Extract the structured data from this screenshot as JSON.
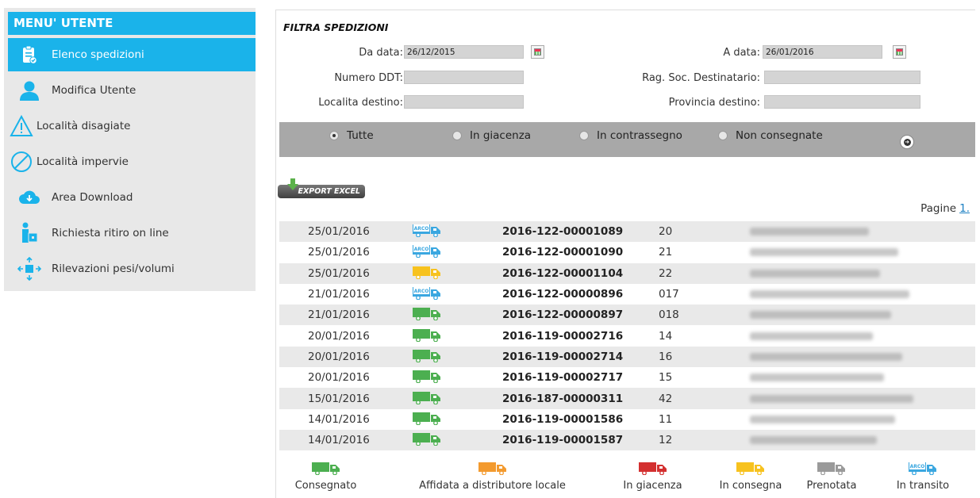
{
  "sidebar": {
    "title": "MENU' UTENTE",
    "items": [
      {
        "label": "Elenco spedizioni",
        "icon": "clipboard-icon",
        "active": true
      },
      {
        "label": "Modifica Utente",
        "icon": "user-icon",
        "active": false
      },
      {
        "label": "Località disagiate",
        "icon": "warning-icon",
        "active": false
      },
      {
        "label": "Località impervie",
        "icon": "forbidden-icon",
        "active": false
      },
      {
        "label": "Area Download",
        "icon": "cloud-download-icon",
        "active": false
      },
      {
        "label": "Richiesta ritiro on line",
        "icon": "person-box-icon",
        "active": false
      },
      {
        "label": "Rilevazioni pesi/volumi",
        "icon": "box-arrows-icon",
        "active": false
      }
    ]
  },
  "filter": {
    "title": "FILTRA SPEDIZIONI",
    "da_data_label": "Da data:",
    "da_data_value": "26/12/2015",
    "a_data_label": "A data:",
    "a_data_value": "26/01/2016",
    "numero_ddt_label": "Numero DDT:",
    "numero_ddt_value": "",
    "rag_soc_label": "Rag. Soc. Destinatario:",
    "rag_soc_value": "",
    "localita_label": "Localita destino:",
    "localita_value": "",
    "provincia_label": "Provincia destino:",
    "provincia_value": "",
    "radios": [
      {
        "label": "Tutte",
        "selected": true
      },
      {
        "label": "In giacenza",
        "selected": false
      },
      {
        "label": "In contrassegno",
        "selected": false
      },
      {
        "label": "Non consegnate",
        "selected": false
      }
    ]
  },
  "export_label": "EXPORT EXCEL",
  "pagination": {
    "label": "Pagine",
    "current": "1."
  },
  "shipments": [
    {
      "date": "25/01/2016",
      "status": "in-transito",
      "ddt": "2016-122-00001089",
      "num": "20"
    },
    {
      "date": "25/01/2016",
      "status": "in-transito",
      "ddt": "2016-122-00001090",
      "num": "21"
    },
    {
      "date": "25/01/2016",
      "status": "in-consegna",
      "ddt": "2016-122-00001104",
      "num": "22"
    },
    {
      "date": "21/01/2016",
      "status": "in-transito",
      "ddt": "2016-122-00000896",
      "num": "017"
    },
    {
      "date": "21/01/2016",
      "status": "consegnato",
      "ddt": "2016-122-00000897",
      "num": "018"
    },
    {
      "date": "20/01/2016",
      "status": "consegnato",
      "ddt": "2016-119-00002716",
      "num": "14"
    },
    {
      "date": "20/01/2016",
      "status": "consegnato",
      "ddt": "2016-119-00002714",
      "num": "16"
    },
    {
      "date": "20/01/2016",
      "status": "consegnato",
      "ddt": "2016-119-00002717",
      "num": "15"
    },
    {
      "date": "15/01/2016",
      "status": "consegnato",
      "ddt": "2016-187-00000311",
      "num": "42"
    },
    {
      "date": "14/01/2016",
      "status": "consegnato",
      "ddt": "2016-119-00001586",
      "num": "11"
    },
    {
      "date": "14/01/2016",
      "status": "consegnato",
      "ddt": "2016-119-00001587",
      "num": "12"
    }
  ],
  "legend": [
    {
      "label": "Consegnato",
      "status": "consegnato"
    },
    {
      "label": "Affidata a distributore locale",
      "status": "distributore"
    },
    {
      "label": "In giacenza",
      "status": "giacenza"
    },
    {
      "label": "In consegna",
      "status": "in-consegna"
    },
    {
      "label": "Prenotata",
      "status": "prenotata"
    },
    {
      "label": "In transito",
      "status": "in-transito"
    }
  ],
  "truck_label": "ARCO",
  "colors": {
    "accent": "#1ab3ea",
    "consegnato": "#4caf50",
    "distributore": "#f39a2e",
    "giacenza": "#d32f2f",
    "in-consegna": "#f7c21e",
    "prenotata": "#9a9a9a",
    "in-transito": "#3aa7e0"
  }
}
